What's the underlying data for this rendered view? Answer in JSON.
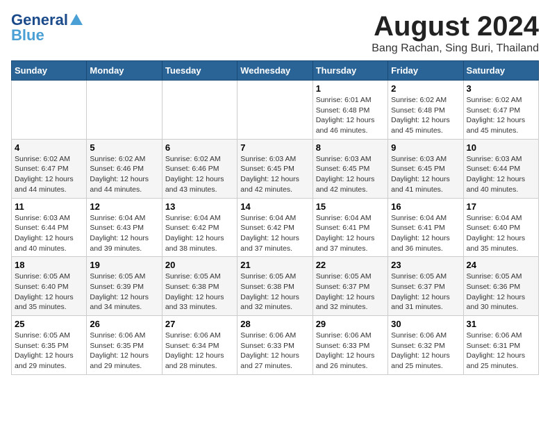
{
  "header": {
    "logo_line1": "General",
    "logo_line2": "Blue",
    "month_title": "August 2024",
    "location": "Bang Rachan, Sing Buri, Thailand"
  },
  "days_of_week": [
    "Sunday",
    "Monday",
    "Tuesday",
    "Wednesday",
    "Thursday",
    "Friday",
    "Saturday"
  ],
  "weeks": [
    [
      {
        "day": "",
        "info": ""
      },
      {
        "day": "",
        "info": ""
      },
      {
        "day": "",
        "info": ""
      },
      {
        "day": "",
        "info": ""
      },
      {
        "day": "1",
        "info": "Sunrise: 6:01 AM\nSunset: 6:48 PM\nDaylight: 12 hours\nand 46 minutes."
      },
      {
        "day": "2",
        "info": "Sunrise: 6:02 AM\nSunset: 6:48 PM\nDaylight: 12 hours\nand 45 minutes."
      },
      {
        "day": "3",
        "info": "Sunrise: 6:02 AM\nSunset: 6:47 PM\nDaylight: 12 hours\nand 45 minutes."
      }
    ],
    [
      {
        "day": "4",
        "info": "Sunrise: 6:02 AM\nSunset: 6:47 PM\nDaylight: 12 hours\nand 44 minutes."
      },
      {
        "day": "5",
        "info": "Sunrise: 6:02 AM\nSunset: 6:46 PM\nDaylight: 12 hours\nand 44 minutes."
      },
      {
        "day": "6",
        "info": "Sunrise: 6:02 AM\nSunset: 6:46 PM\nDaylight: 12 hours\nand 43 minutes."
      },
      {
        "day": "7",
        "info": "Sunrise: 6:03 AM\nSunset: 6:45 PM\nDaylight: 12 hours\nand 42 minutes."
      },
      {
        "day": "8",
        "info": "Sunrise: 6:03 AM\nSunset: 6:45 PM\nDaylight: 12 hours\nand 42 minutes."
      },
      {
        "day": "9",
        "info": "Sunrise: 6:03 AM\nSunset: 6:45 PM\nDaylight: 12 hours\nand 41 minutes."
      },
      {
        "day": "10",
        "info": "Sunrise: 6:03 AM\nSunset: 6:44 PM\nDaylight: 12 hours\nand 40 minutes."
      }
    ],
    [
      {
        "day": "11",
        "info": "Sunrise: 6:03 AM\nSunset: 6:44 PM\nDaylight: 12 hours\nand 40 minutes."
      },
      {
        "day": "12",
        "info": "Sunrise: 6:04 AM\nSunset: 6:43 PM\nDaylight: 12 hours\nand 39 minutes."
      },
      {
        "day": "13",
        "info": "Sunrise: 6:04 AM\nSunset: 6:42 PM\nDaylight: 12 hours\nand 38 minutes."
      },
      {
        "day": "14",
        "info": "Sunrise: 6:04 AM\nSunset: 6:42 PM\nDaylight: 12 hours\nand 37 minutes."
      },
      {
        "day": "15",
        "info": "Sunrise: 6:04 AM\nSunset: 6:41 PM\nDaylight: 12 hours\nand 37 minutes."
      },
      {
        "day": "16",
        "info": "Sunrise: 6:04 AM\nSunset: 6:41 PM\nDaylight: 12 hours\nand 36 minutes."
      },
      {
        "day": "17",
        "info": "Sunrise: 6:04 AM\nSunset: 6:40 PM\nDaylight: 12 hours\nand 35 minutes."
      }
    ],
    [
      {
        "day": "18",
        "info": "Sunrise: 6:05 AM\nSunset: 6:40 PM\nDaylight: 12 hours\nand 35 minutes."
      },
      {
        "day": "19",
        "info": "Sunrise: 6:05 AM\nSunset: 6:39 PM\nDaylight: 12 hours\nand 34 minutes."
      },
      {
        "day": "20",
        "info": "Sunrise: 6:05 AM\nSunset: 6:38 PM\nDaylight: 12 hours\nand 33 minutes."
      },
      {
        "day": "21",
        "info": "Sunrise: 6:05 AM\nSunset: 6:38 PM\nDaylight: 12 hours\nand 32 minutes."
      },
      {
        "day": "22",
        "info": "Sunrise: 6:05 AM\nSunset: 6:37 PM\nDaylight: 12 hours\nand 32 minutes."
      },
      {
        "day": "23",
        "info": "Sunrise: 6:05 AM\nSunset: 6:37 PM\nDaylight: 12 hours\nand 31 minutes."
      },
      {
        "day": "24",
        "info": "Sunrise: 6:05 AM\nSunset: 6:36 PM\nDaylight: 12 hours\nand 30 minutes."
      }
    ],
    [
      {
        "day": "25",
        "info": "Sunrise: 6:05 AM\nSunset: 6:35 PM\nDaylight: 12 hours\nand 29 minutes."
      },
      {
        "day": "26",
        "info": "Sunrise: 6:06 AM\nSunset: 6:35 PM\nDaylight: 12 hours\nand 29 minutes."
      },
      {
        "day": "27",
        "info": "Sunrise: 6:06 AM\nSunset: 6:34 PM\nDaylight: 12 hours\nand 28 minutes."
      },
      {
        "day": "28",
        "info": "Sunrise: 6:06 AM\nSunset: 6:33 PM\nDaylight: 12 hours\nand 27 minutes."
      },
      {
        "day": "29",
        "info": "Sunrise: 6:06 AM\nSunset: 6:33 PM\nDaylight: 12 hours\nand 26 minutes."
      },
      {
        "day": "30",
        "info": "Sunrise: 6:06 AM\nSunset: 6:32 PM\nDaylight: 12 hours\nand 25 minutes."
      },
      {
        "day": "31",
        "info": "Sunrise: 6:06 AM\nSunset: 6:31 PM\nDaylight: 12 hours\nand 25 minutes."
      }
    ]
  ]
}
